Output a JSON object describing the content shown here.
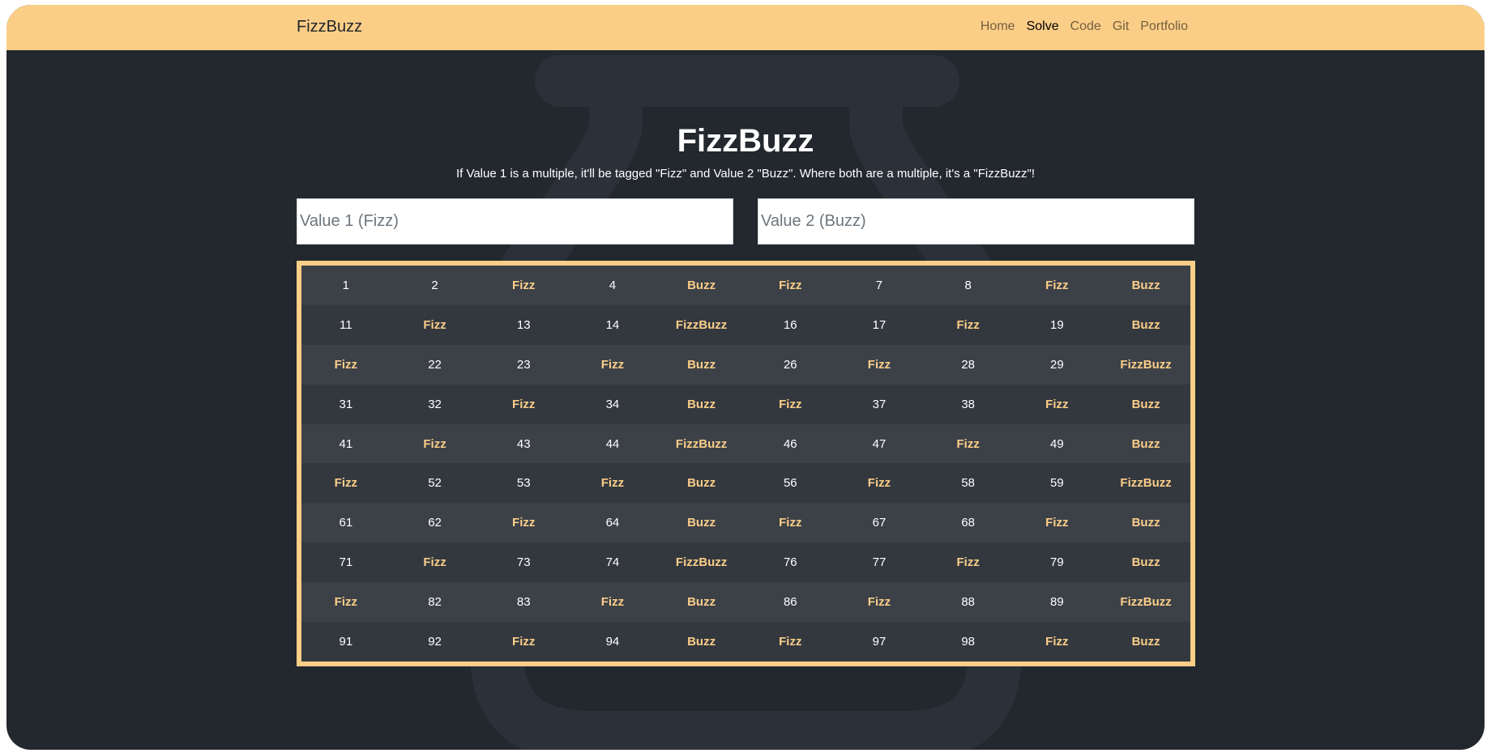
{
  "colors": {
    "accent": "#fbce88",
    "background": "#23272e",
    "row_odd": "#3c4148",
    "row_even": "#33383f",
    "text": "#ffffff"
  },
  "navbar": {
    "brand": "FizzBuzz",
    "links": [
      {
        "label": "Home",
        "active": false
      },
      {
        "label": "Solve",
        "active": true
      },
      {
        "label": "Code",
        "active": false
      },
      {
        "label": "Git",
        "active": false
      },
      {
        "label": "Portfolio",
        "active": false
      }
    ]
  },
  "main": {
    "title": "FizzBuzz",
    "subtitle": "If Value 1 is a multiple, it'll be tagged \"Fizz\" and Value 2 \"Buzz\". Where both are a multiple, it's a \"FizzBuzz\"!",
    "inputs": {
      "value1": {
        "value": "",
        "placeholder": "Value 1 (Fizz)"
      },
      "value2": {
        "value": "",
        "placeholder": "Value 2 (Buzz)"
      }
    },
    "results": {
      "rows": [
        [
          "1",
          "2",
          "Fizz",
          "4",
          "Buzz",
          "Fizz",
          "7",
          "8",
          "Fizz",
          "Buzz"
        ],
        [
          "11",
          "Fizz",
          "13",
          "14",
          "FizzBuzz",
          "16",
          "17",
          "Fizz",
          "19",
          "Buzz"
        ],
        [
          "Fizz",
          "22",
          "23",
          "Fizz",
          "Buzz",
          "26",
          "Fizz",
          "28",
          "29",
          "FizzBuzz"
        ],
        [
          "31",
          "32",
          "Fizz",
          "34",
          "Buzz",
          "Fizz",
          "37",
          "38",
          "Fizz",
          "Buzz"
        ],
        [
          "41",
          "Fizz",
          "43",
          "44",
          "FizzBuzz",
          "46",
          "47",
          "Fizz",
          "49",
          "Buzz"
        ],
        [
          "Fizz",
          "52",
          "53",
          "Fizz",
          "Buzz",
          "56",
          "Fizz",
          "58",
          "59",
          "FizzBuzz"
        ],
        [
          "61",
          "62",
          "Fizz",
          "64",
          "Buzz",
          "Fizz",
          "67",
          "68",
          "Fizz",
          "Buzz"
        ],
        [
          "71",
          "Fizz",
          "73",
          "74",
          "FizzBuzz",
          "76",
          "77",
          "Fizz",
          "79",
          "Buzz"
        ],
        [
          "Fizz",
          "82",
          "83",
          "Fizz",
          "Buzz",
          "86",
          "Fizz",
          "88",
          "89",
          "FizzBuzz"
        ],
        [
          "91",
          "92",
          "Fizz",
          "94",
          "Buzz",
          "Fizz",
          "97",
          "98",
          "Fizz",
          "Buzz"
        ]
      ]
    }
  },
  "background_icon": "jar-icon"
}
